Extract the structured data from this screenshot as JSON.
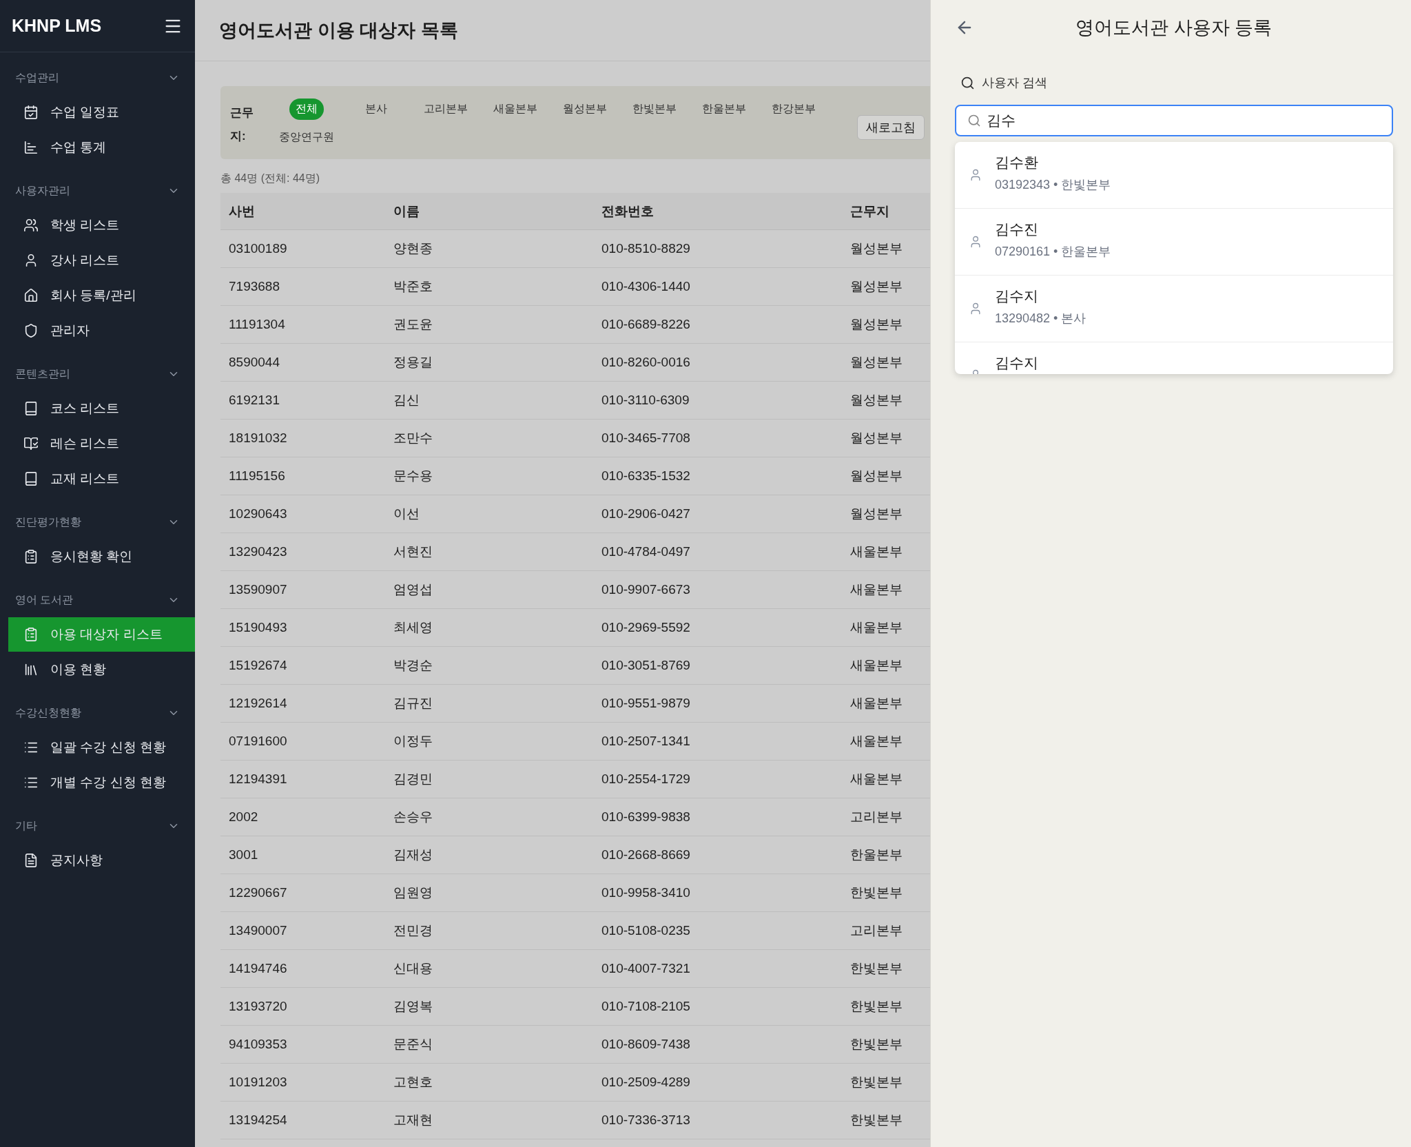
{
  "sidebar": {
    "brand": "KHNP LMS",
    "sections": [
      {
        "title": "수업관리",
        "expanded": true,
        "items": [
          {
            "label": "수업 일정표",
            "selected": false
          },
          {
            "label": "수업 통계",
            "selected": false
          }
        ]
      },
      {
        "title": "사용자관리",
        "expanded": true,
        "items": [
          {
            "label": "학생 리스트",
            "selected": false
          },
          {
            "label": "강사 리스트",
            "selected": false
          },
          {
            "label": "회사 등록/관리",
            "selected": false
          },
          {
            "label": "관리자",
            "selected": false
          }
        ]
      },
      {
        "title": "콘텐츠관리",
        "expanded": true,
        "items": [
          {
            "label": "코스 리스트",
            "selected": false
          },
          {
            "label": "레슨 리스트",
            "selected": false
          },
          {
            "label": "교재 리스트",
            "selected": false
          }
        ]
      },
      {
        "title": "진단평가현황",
        "expanded": true,
        "items": [
          {
            "label": "응시현황 확인",
            "selected": false
          }
        ]
      },
      {
        "title": "영어 도서관",
        "expanded": true,
        "items": [
          {
            "label": "아용 대상자 리스트",
            "selected": true
          },
          {
            "label": "이용 현황",
            "selected": false
          }
        ]
      },
      {
        "title": "수강신청현황",
        "expanded": true,
        "items": [
          {
            "label": "일괄 수강 신청 현황",
            "selected": false
          },
          {
            "label": "개별 수강 신청 현황",
            "selected": false
          }
        ]
      },
      {
        "title": "기타",
        "expanded": true,
        "items": [
          {
            "label": "공지사항",
            "selected": false
          }
        ]
      }
    ]
  },
  "page": {
    "title": "영어도서관 이용 대상자 목록",
    "filter": {
      "label": "근무지:",
      "options": [
        {
          "label": "전체",
          "selected": true
        },
        {
          "label": "본사",
          "selected": false
        },
        {
          "label": "고리본부",
          "selected": false
        },
        {
          "label": "새울본부",
          "selected": false
        },
        {
          "label": "월성본부",
          "selected": false
        },
        {
          "label": "한빛본부",
          "selected": false
        },
        {
          "label": "한울본부",
          "selected": false
        },
        {
          "label": "한강본부",
          "selected": false
        },
        {
          "label": "중앙연구원",
          "selected": false
        }
      ],
      "refresh_button": "새로고침"
    },
    "count": "총 44명 (전체: 44명)",
    "table": {
      "columns": [
        "사번",
        "이름",
        "전화번호",
        "근무지"
      ],
      "rows": [
        [
          "03100189",
          "양현종",
          "010-8510-8829",
          "월성본부"
        ],
        [
          "7193688",
          "박준호",
          "010-4306-1440",
          "월성본부"
        ],
        [
          "11191304",
          "권도윤",
          "010-6689-8226",
          "월성본부"
        ],
        [
          "8590044",
          "정용길",
          "010-8260-0016",
          "월성본부"
        ],
        [
          "6192131",
          "김신",
          "010-3110-6309",
          "월성본부"
        ],
        [
          "18191032",
          "조만수",
          "010-3465-7708",
          "월성본부"
        ],
        [
          "11195156",
          "문수용",
          "010-6335-1532",
          "월성본부"
        ],
        [
          "10290643",
          "이선",
          "010-2906-0427",
          "월성본부"
        ],
        [
          "13290423",
          "서현진",
          "010-4784-0497",
          "새울본부"
        ],
        [
          "13590907",
          "엄영섭",
          "010-9907-6673",
          "새울본부"
        ],
        [
          "15190493",
          "최세영",
          "010-2969-5592",
          "새울본부"
        ],
        [
          "15192674",
          "박경순",
          "010-3051-8769",
          "새울본부"
        ],
        [
          "12192614",
          "김규진",
          "010-9551-9879",
          "새울본부"
        ],
        [
          "07191600",
          "이정두",
          "010-2507-1341",
          "새울본부"
        ],
        [
          "12194391",
          "김경민",
          "010-2554-1729",
          "새울본부"
        ],
        [
          "2002",
          "손승우",
          "010-6399-9838",
          "고리본부"
        ],
        [
          "3001",
          "김재성",
          "010-2668-8669",
          "한울본부"
        ],
        [
          "12290667",
          "임원영",
          "010-9958-3410",
          "한빛본부"
        ],
        [
          "13490007",
          "전민경",
          "010-5108-0235",
          "고리본부"
        ],
        [
          "14194746",
          "신대용",
          "010-4007-7321",
          "한빛본부"
        ],
        [
          "13193720",
          "김영복",
          "010-7108-2105",
          "한빛본부"
        ],
        [
          "94109353",
          "문준식",
          "010-8609-7438",
          "한빛본부"
        ],
        [
          "10191203",
          "고현호",
          "010-2509-4289",
          "한빛본부"
        ],
        [
          "13194254",
          "고재현",
          "010-7336-3713",
          "한빛본부"
        ]
      ]
    }
  },
  "panel": {
    "title": "영어도서관 사용자 등록",
    "search_label": "사용자 검색",
    "search": {
      "value": "김수"
    },
    "results": [
      {
        "name": "김수환",
        "detail": "03192343 • 한빛본부"
      },
      {
        "name": "김수진",
        "detail": "07290161 • 한울본부"
      },
      {
        "name": "김수지",
        "detail": "13290482 • 본사"
      },
      {
        "name": "김수지"
      }
    ]
  }
}
